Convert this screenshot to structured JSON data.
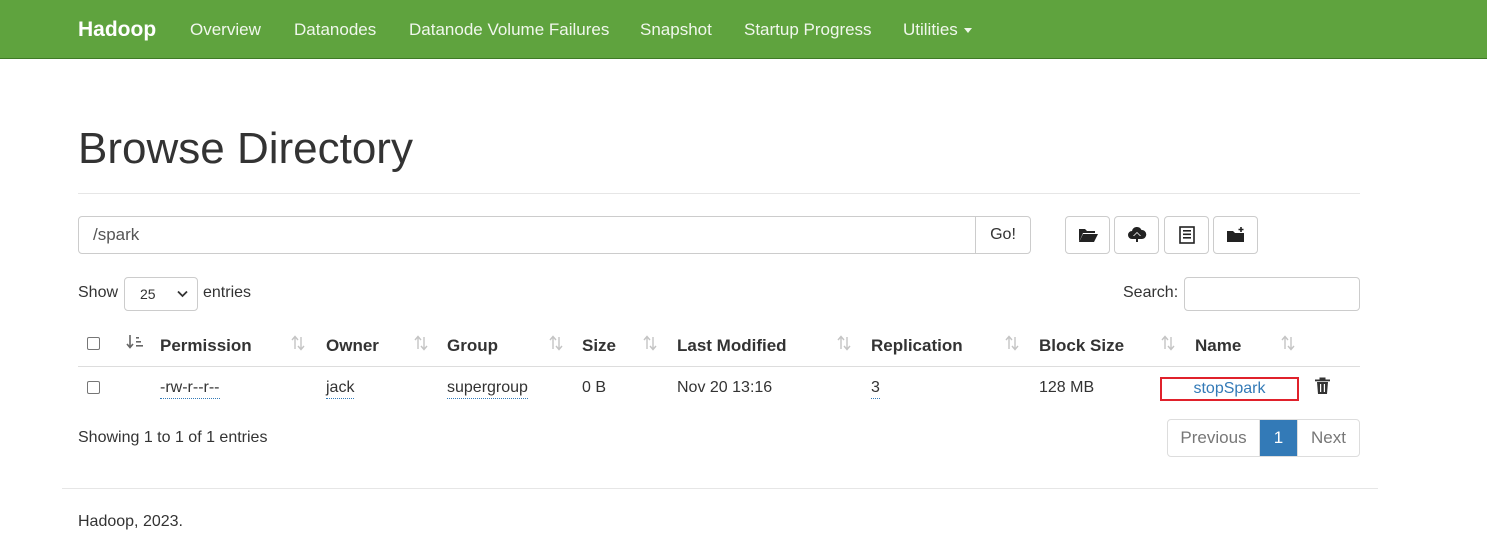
{
  "navbar": {
    "brand": "Hadoop",
    "items": [
      "Overview",
      "Datanodes",
      "Datanode Volume Failures",
      "Snapshot",
      "Startup Progress",
      "Utilities"
    ],
    "background": "#5fa33e"
  },
  "page": {
    "title": "Browse Directory"
  },
  "path_bar": {
    "value": "/spark",
    "go_label": "Go!"
  },
  "toolbar": {
    "icons": [
      "open-folder-icon",
      "upload-icon",
      "list-icon",
      "new-folder-icon"
    ]
  },
  "table_controls": {
    "show_label": "Show",
    "entries_value": "25",
    "entries_label": "entries",
    "search_label": "Search:"
  },
  "table": {
    "columns": [
      "Permission",
      "Owner",
      "Group",
      "Size",
      "Last Modified",
      "Replication",
      "Block Size",
      "Name"
    ],
    "rows": [
      {
        "permission": "-rw-r--r--",
        "owner": "jack",
        "group": "supergroup",
        "size": "0 B",
        "last_modified": "Nov 20 13:16",
        "replication": "3",
        "block_size": "128 MB",
        "name": "stopSpark"
      }
    ]
  },
  "pagination": {
    "info": "Showing 1 to 1 of 1 entries",
    "previous": "Previous",
    "current": "1",
    "next": "Next"
  },
  "footer": {
    "text": "Hadoop, 2023."
  },
  "colors": {
    "link": "#337ab7",
    "highlight_border": "#e0212b",
    "active_page": "#337ab7"
  }
}
